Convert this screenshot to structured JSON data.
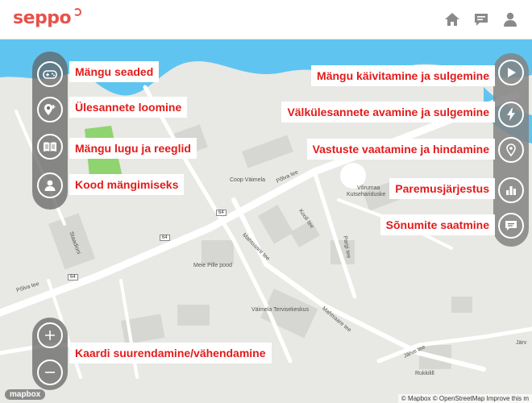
{
  "app": {
    "logo": "seppo"
  },
  "topbar": {
    "icons": [
      "home-icon",
      "message-icon",
      "user-icon"
    ]
  },
  "left_controls": [
    {
      "icon": "gamepad-icon",
      "label": "Mängu seaded"
    },
    {
      "icon": "add-location-icon",
      "label": "Ülesannete loomine"
    },
    {
      "icon": "book-icon",
      "label": "Mängu lugu ja reeglid"
    },
    {
      "icon": "user-icon",
      "label": "Kood mängimiseks"
    }
  ],
  "right_controls": [
    {
      "icon": "play-icon",
      "label": "Mängu käivitamine ja sulgemine"
    },
    {
      "icon": "lightning-icon",
      "label": "Välkülesannete avamine ja sulgemine"
    },
    {
      "icon": "review-icon",
      "label": "Vastuste vaatamine ja hindamine"
    },
    {
      "icon": "leaderboard-icon",
      "label": "Paremusjärjestus"
    },
    {
      "icon": "chat-icon",
      "label": "Sõnumite saatmine"
    }
  ],
  "zoom": {
    "label": "Kaardi suurendamine/vähendamine",
    "in_icon": "zoom-in-icon",
    "out_icon": "zoom-out-icon"
  },
  "map_labels": {
    "coop": "Coop Väimela",
    "vorumaa": "Võrumaa",
    "kutse": "Kutsehariduske",
    "meie_pille": "Meie Pille pood",
    "tervise": "Väimela Tervisekeskus",
    "rukkilill": "Rukkilill",
    "polva_tee_1": "Põlva tee",
    "polva_tee_2": "Põlva tee",
    "mahtsaare_1": "Mahtsaare tee",
    "mahtsaare_2": "Mahtsaare tee",
    "kooli": "Kooli tee",
    "pargi": "Pargi tee",
    "staadioni": "Staadioni",
    "jarve_1": "Järve tee",
    "jarve_2": "Järv",
    "road64_a": "64",
    "road64_b": "64",
    "road64_c": "64"
  },
  "attribution": {
    "left": "mapbox",
    "right": "© Mapbox © OpenStreetMap Improve this m"
  },
  "colors": {
    "label_text": "#e31b1b",
    "logo": "#e8524a",
    "water": "#5fc5f0",
    "park": "#8fd46f",
    "pill": "#5f5f5f"
  }
}
